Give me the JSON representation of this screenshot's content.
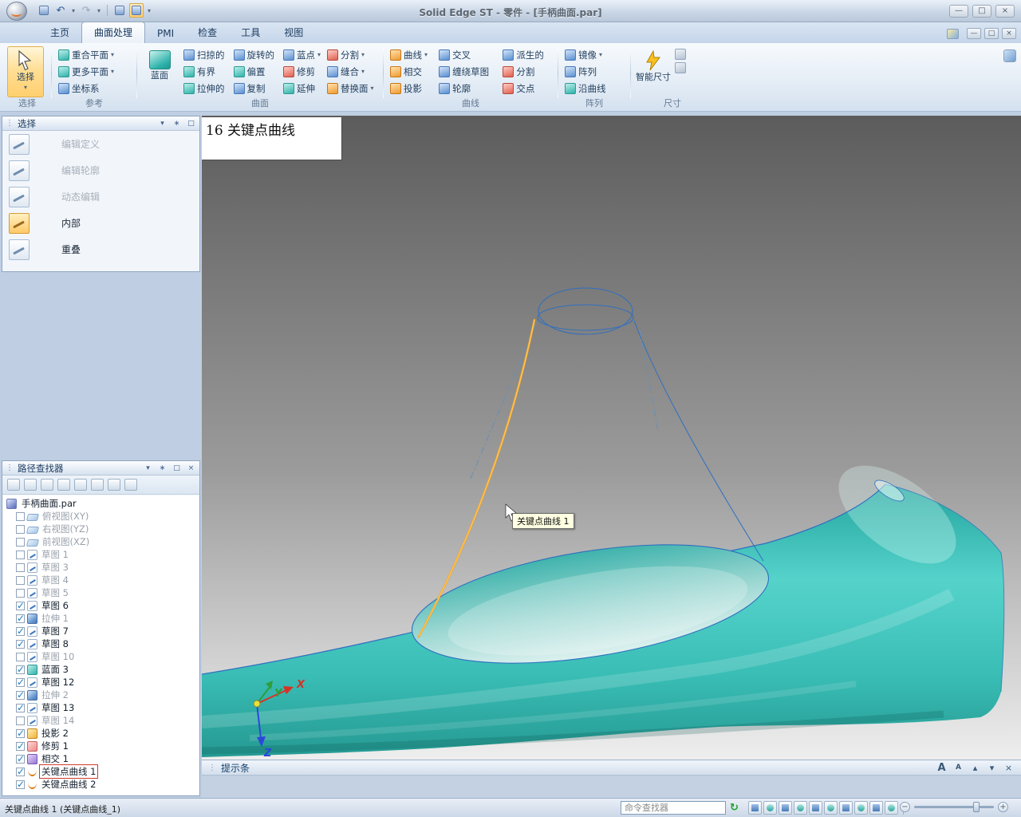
{
  "window": {
    "title": "Solid Edge ST - 零件 - [手柄曲面.par]"
  },
  "tabs": [
    {
      "label": "主页",
      "cls": ""
    },
    {
      "label": "曲面处理",
      "cls": "active"
    },
    {
      "label": "PMI",
      "cls": ""
    },
    {
      "label": "检查",
      "cls": ""
    },
    {
      "label": "工具",
      "cls": ""
    },
    {
      "label": "视图",
      "cls": ""
    }
  ],
  "ribbon": {
    "select": {
      "label": "选择",
      "group": "选择",
      "arrow": "▾"
    },
    "reference": {
      "group": "参考",
      "buttons": [
        {
          "label": "重合平面",
          "arrow": "▾"
        },
        {
          "label": "更多平面",
          "arrow": "▾"
        },
        {
          "label": "坐标系",
          "arrow": ""
        }
      ]
    },
    "surface": {
      "group": "曲面",
      "big": {
        "label": "蓝面"
      },
      "buttons": [
        {
          "label": "扫掠的"
        },
        {
          "label": "旋转的"
        },
        {
          "label": "蓝点",
          "arrow": "▾"
        },
        {
          "label": "分割",
          "arrow": "▾"
        },
        {
          "label": "有界"
        },
        {
          "label": "偏置"
        },
        {
          "label": "修剪"
        },
        {
          "label": "缝合",
          "arrow": "▾"
        },
        {
          "label": "拉伸的"
        },
        {
          "label": "复制"
        },
        {
          "label": "延伸"
        },
        {
          "label": "替换面",
          "arrow": "▾"
        }
      ]
    },
    "curve": {
      "group": "曲线",
      "buttons": [
        {
          "label": "曲线",
          "arrow": "▾"
        },
        {
          "label": "交叉"
        },
        {
          "label": "派生的"
        },
        {
          "label": "相交"
        },
        {
          "label": "缠绕草图"
        },
        {
          "label": "分割"
        },
        {
          "label": "投影"
        },
        {
          "label": "轮廓"
        },
        {
          "label": "交点"
        }
      ]
    },
    "pattern": {
      "group": "阵列",
      "buttons": [
        {
          "label": "镜像",
          "arrow": "▾"
        },
        {
          "label": "阵列"
        },
        {
          "label": "沿曲线"
        }
      ]
    },
    "dimension": {
      "group": "尺寸",
      "big": {
        "label": "智能尺寸"
      }
    }
  },
  "select_panel": {
    "title": "选择",
    "items": [
      {
        "label": "编辑定义",
        "cls": "disabled"
      },
      {
        "label": "编辑轮廓",
        "cls": "disabled"
      },
      {
        "label": "动态编辑",
        "cls": "disabled"
      },
      {
        "label": "内部",
        "cls": "active"
      },
      {
        "label": "重叠",
        "cls": ""
      }
    ]
  },
  "pathfinder": {
    "title": "路径查找器",
    "root": "手柄曲面.par",
    "items": [
      {
        "label": "俯视图(XY)",
        "cls": "dim",
        "icon": "plane"
      },
      {
        "label": "右视图(YZ)",
        "cls": "dim",
        "icon": "plane"
      },
      {
        "label": "前视图(XZ)",
        "cls": "dim",
        "icon": "plane"
      },
      {
        "label": "草图 1",
        "cls": "dim",
        "icon": "sketch"
      },
      {
        "label": "草图 3",
        "cls": "dim",
        "icon": "sketch"
      },
      {
        "label": "草图 4",
        "cls": "dim",
        "icon": "sketch"
      },
      {
        "label": "草图 5",
        "cls": "dim",
        "icon": "sketch"
      },
      {
        "label": "草图 6",
        "cls": "chk",
        "icon": "sketch"
      },
      {
        "label": "拉伸 1",
        "cls": "chk dim",
        "icon": "extrude"
      },
      {
        "label": "草图 7",
        "cls": "chk",
        "icon": "sketch"
      },
      {
        "label": "草图 8",
        "cls": "chk",
        "icon": "sketch"
      },
      {
        "label": "草图 10",
        "cls": "dim",
        "icon": "sketch"
      },
      {
        "label": "蓝面 3",
        "cls": "chk",
        "icon": "surface"
      },
      {
        "label": "草图 12",
        "cls": "chk",
        "icon": "sketch"
      },
      {
        "label": "拉伸 2",
        "cls": "chk dim",
        "icon": "extrude"
      },
      {
        "label": "草图 13",
        "cls": "chk",
        "icon": "sketch"
      },
      {
        "label": "草图 14",
        "cls": "dim",
        "icon": "sketch"
      },
      {
        "label": "投影 2",
        "cls": "chk",
        "icon": "project"
      },
      {
        "label": "修剪 1",
        "cls": "chk",
        "icon": "trim"
      },
      {
        "label": "相交 1",
        "cls": "chk",
        "icon": "intersect"
      },
      {
        "label": "关键点曲线 1",
        "cls": "chk sel",
        "icon": "keycurve"
      },
      {
        "label": "关键点曲线 2",
        "cls": "chk",
        "icon": "keycurve"
      }
    ]
  },
  "viewport": {
    "annotation": "16 关键点曲线",
    "tooltip": "关键点曲线 1",
    "axes": {
      "x": "X",
      "y": "Y",
      "z": "Z"
    },
    "colors": {
      "model": "#3cc4bc",
      "edges": "#2f6fbf",
      "highlight_curve": "#f5a52e",
      "background_top": "#5c5c5c",
      "background_bottom": "#eeeeee"
    }
  },
  "prompt_bar": {
    "label": "提示条"
  },
  "status_bar": {
    "text": "关键点曲线 1 (关键点曲线_1)",
    "command_finder": "命令查找器"
  }
}
